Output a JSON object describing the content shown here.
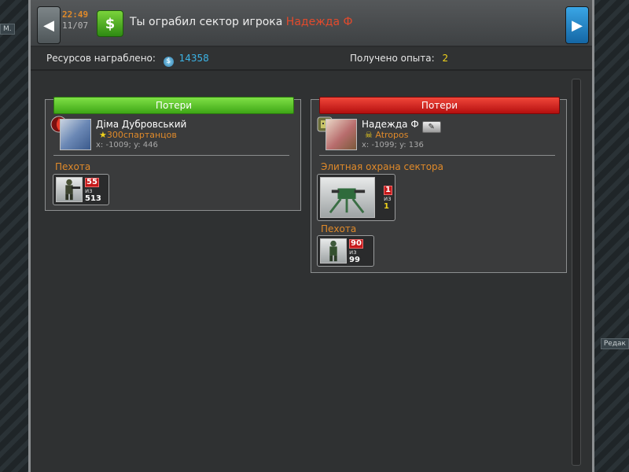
{
  "background": {
    "left_tab": "М.",
    "right_tab": "Редак"
  },
  "header": {
    "time": "22:49",
    "date": "11/07",
    "title_prefix": "Ты ограбил сектор игрока",
    "enemy_name": "Надежда Ф"
  },
  "stats": {
    "resources_label": "Ресурсов награблено:",
    "resources_value": "14358",
    "experience_label": "Получено опыта:",
    "experience_value": "2"
  },
  "attacker": {
    "losses_label": "Потери",
    "name": "Діма Дубровський",
    "alliance": "300спартанцов",
    "coords": "x: -1009; y: 446",
    "groups": [
      {
        "label": "Пехота",
        "units": [
          {
            "lost": "55",
            "of_label": "из",
            "total": "513"
          }
        ]
      }
    ]
  },
  "defender": {
    "losses_label": "Потери",
    "name": "Надежда Ф",
    "alliance": "Atropos",
    "coords": "x: -1099; y: 136",
    "groups": [
      {
        "label": "Элитная охрана сектора",
        "units": [
          {
            "lost": "1",
            "of_label": "из",
            "total": "1"
          }
        ]
      },
      {
        "label": "Пехота",
        "units": [
          {
            "lost": "90",
            "of_label": "из",
            "total": "99"
          }
        ]
      }
    ]
  },
  "colors": {
    "accent_orange": "#e08a2a",
    "enemy_red": "#e34a2c",
    "resource_blue": "#3cb4e6",
    "exp_yellow": "#f0d21c",
    "win_green": "#3ea716",
    "loss_red": "#b40f0f"
  },
  "icons": {
    "prev": "chevron-left-icon",
    "next": "chevron-right-icon",
    "money": "money-icon",
    "coin": "coin-icon",
    "star": "star-icon",
    "skull": "skull-icon",
    "edit": "edit-pencil-icon"
  }
}
